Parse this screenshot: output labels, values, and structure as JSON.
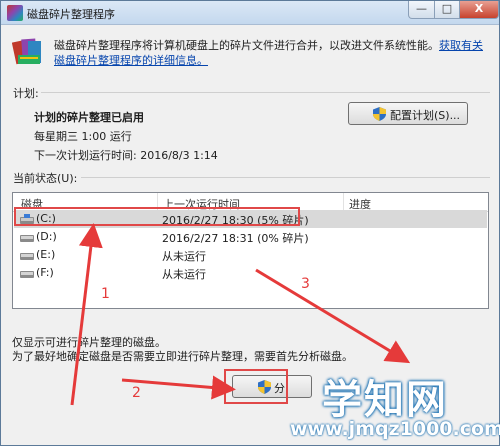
{
  "window": {
    "title": "磁盘碎片整理程序",
    "controls": {
      "minimize": "—",
      "maximize": "□",
      "close": "X"
    }
  },
  "intro": {
    "text": "磁盘碎片整理程序将计算机硬盘上的碎片文件进行合并，以改进文件系统性能。",
    "link": "获取有关磁盘碎片整理程序的详细信息。"
  },
  "schedule": {
    "section_label": "计划:",
    "heading": "计划的碎片整理已启用",
    "line1": "每星期三  1:00 运行",
    "line2": "下一次计划运行时间: 2016/8/3 1:14",
    "config_button": "配置计划(S)..."
  },
  "status": {
    "section_label": "当前状态(U):",
    "columns": [
      "磁盘",
      "上一次运行时间",
      "进度"
    ],
    "rows": [
      {
        "disk": "(C:)",
        "last_run": "2016/2/27 18:30 (5% 碎片)",
        "progress": ""
      },
      {
        "disk": "(D:)",
        "last_run": "2016/2/27 18:31 (0% 碎片)",
        "progress": ""
      },
      {
        "disk": "(E:)",
        "last_run": "从未运行",
        "progress": ""
      },
      {
        "disk": "(F:)",
        "last_run": "从未运行",
        "progress": ""
      }
    ]
  },
  "notes": {
    "line1": "仅显示可进行碎片整理的磁盘。",
    "line2": "为了最好地确定磁盘是否需要立即进行碎片整理，需要首先分析磁盘。"
  },
  "actions": {
    "analyze_button": "分"
  },
  "annotations": {
    "labels": [
      "1",
      "2",
      "3"
    ],
    "color": "#e53a3a"
  },
  "watermark": {
    "main": "学知网",
    "sub": "www.jmqz1000.com"
  }
}
